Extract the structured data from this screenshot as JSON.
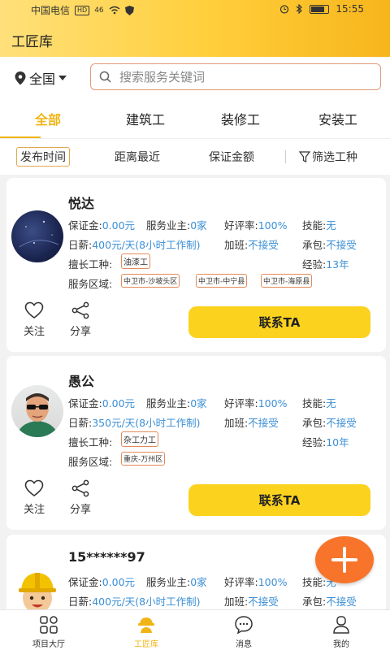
{
  "status": {
    "carrier": "中国电信",
    "hd": "HD",
    "signal": "46",
    "time": "15:55"
  },
  "app": {
    "title": "工匠库"
  },
  "search": {
    "region": "全国",
    "placeholder": "搜索服务关键词"
  },
  "tabs": [
    {
      "label": "全部",
      "active": true
    },
    {
      "label": "建筑工"
    },
    {
      "label": "装修工"
    },
    {
      "label": "安装工"
    }
  ],
  "sorts": [
    "发布时间",
    "距离最近",
    "保证金额",
    "筛选工种"
  ],
  "labels": {
    "deposit": "保证金:",
    "employer": "服务业主:",
    "rating": "好评率:",
    "skill": "技能:",
    "wage": "日薪:",
    "overtime": "加班:",
    "contract": "承包:",
    "trade": "擅长工种:",
    "experience": "经验:",
    "area": "服务区域:",
    "follow": "关注",
    "share": "分享",
    "contact": "联系TA"
  },
  "workers": [
    {
      "name": "悦达",
      "deposit": "0.00元",
      "employer": "0家",
      "rating": "100%",
      "skill": "无",
      "wage": "400元/天(8小时工作制)",
      "overtime": "不接受",
      "contract": "不接受",
      "trade": "油漆工",
      "experience": "13年",
      "areas": [
        "中卫市-沙坡头区",
        "中卫市-中宁县",
        "中卫市-海原县"
      ]
    },
    {
      "name": "愚公",
      "deposit": "0.00元",
      "employer": "0家",
      "rating": "100%",
      "skill": "无",
      "wage": "350元/天(8小时工作制)",
      "overtime": "不接受",
      "contract": "不接受",
      "trade": "杂工力工",
      "experience": "10年",
      "areas": [
        "重庆-万州区"
      ]
    },
    {
      "name": "15******97",
      "deposit": "0.00元",
      "employer": "0家",
      "rating": "100%",
      "skill": "无",
      "wage": "400元/天(8小时工作制)",
      "overtime": "不接受",
      "contract": "不接受"
    }
  ],
  "nav": [
    {
      "label": "项目大厅",
      "icon": "grid-icon"
    },
    {
      "label": "工匠库",
      "icon": "worker-icon",
      "active": true
    },
    {
      "label": "消息",
      "icon": "message-icon"
    },
    {
      "label": "我的",
      "icon": "profile-icon"
    }
  ],
  "colors": {
    "accent": "#f1b416",
    "button": "#fbd21e",
    "link": "#3b8fd6",
    "fab": "#f7742a"
  }
}
